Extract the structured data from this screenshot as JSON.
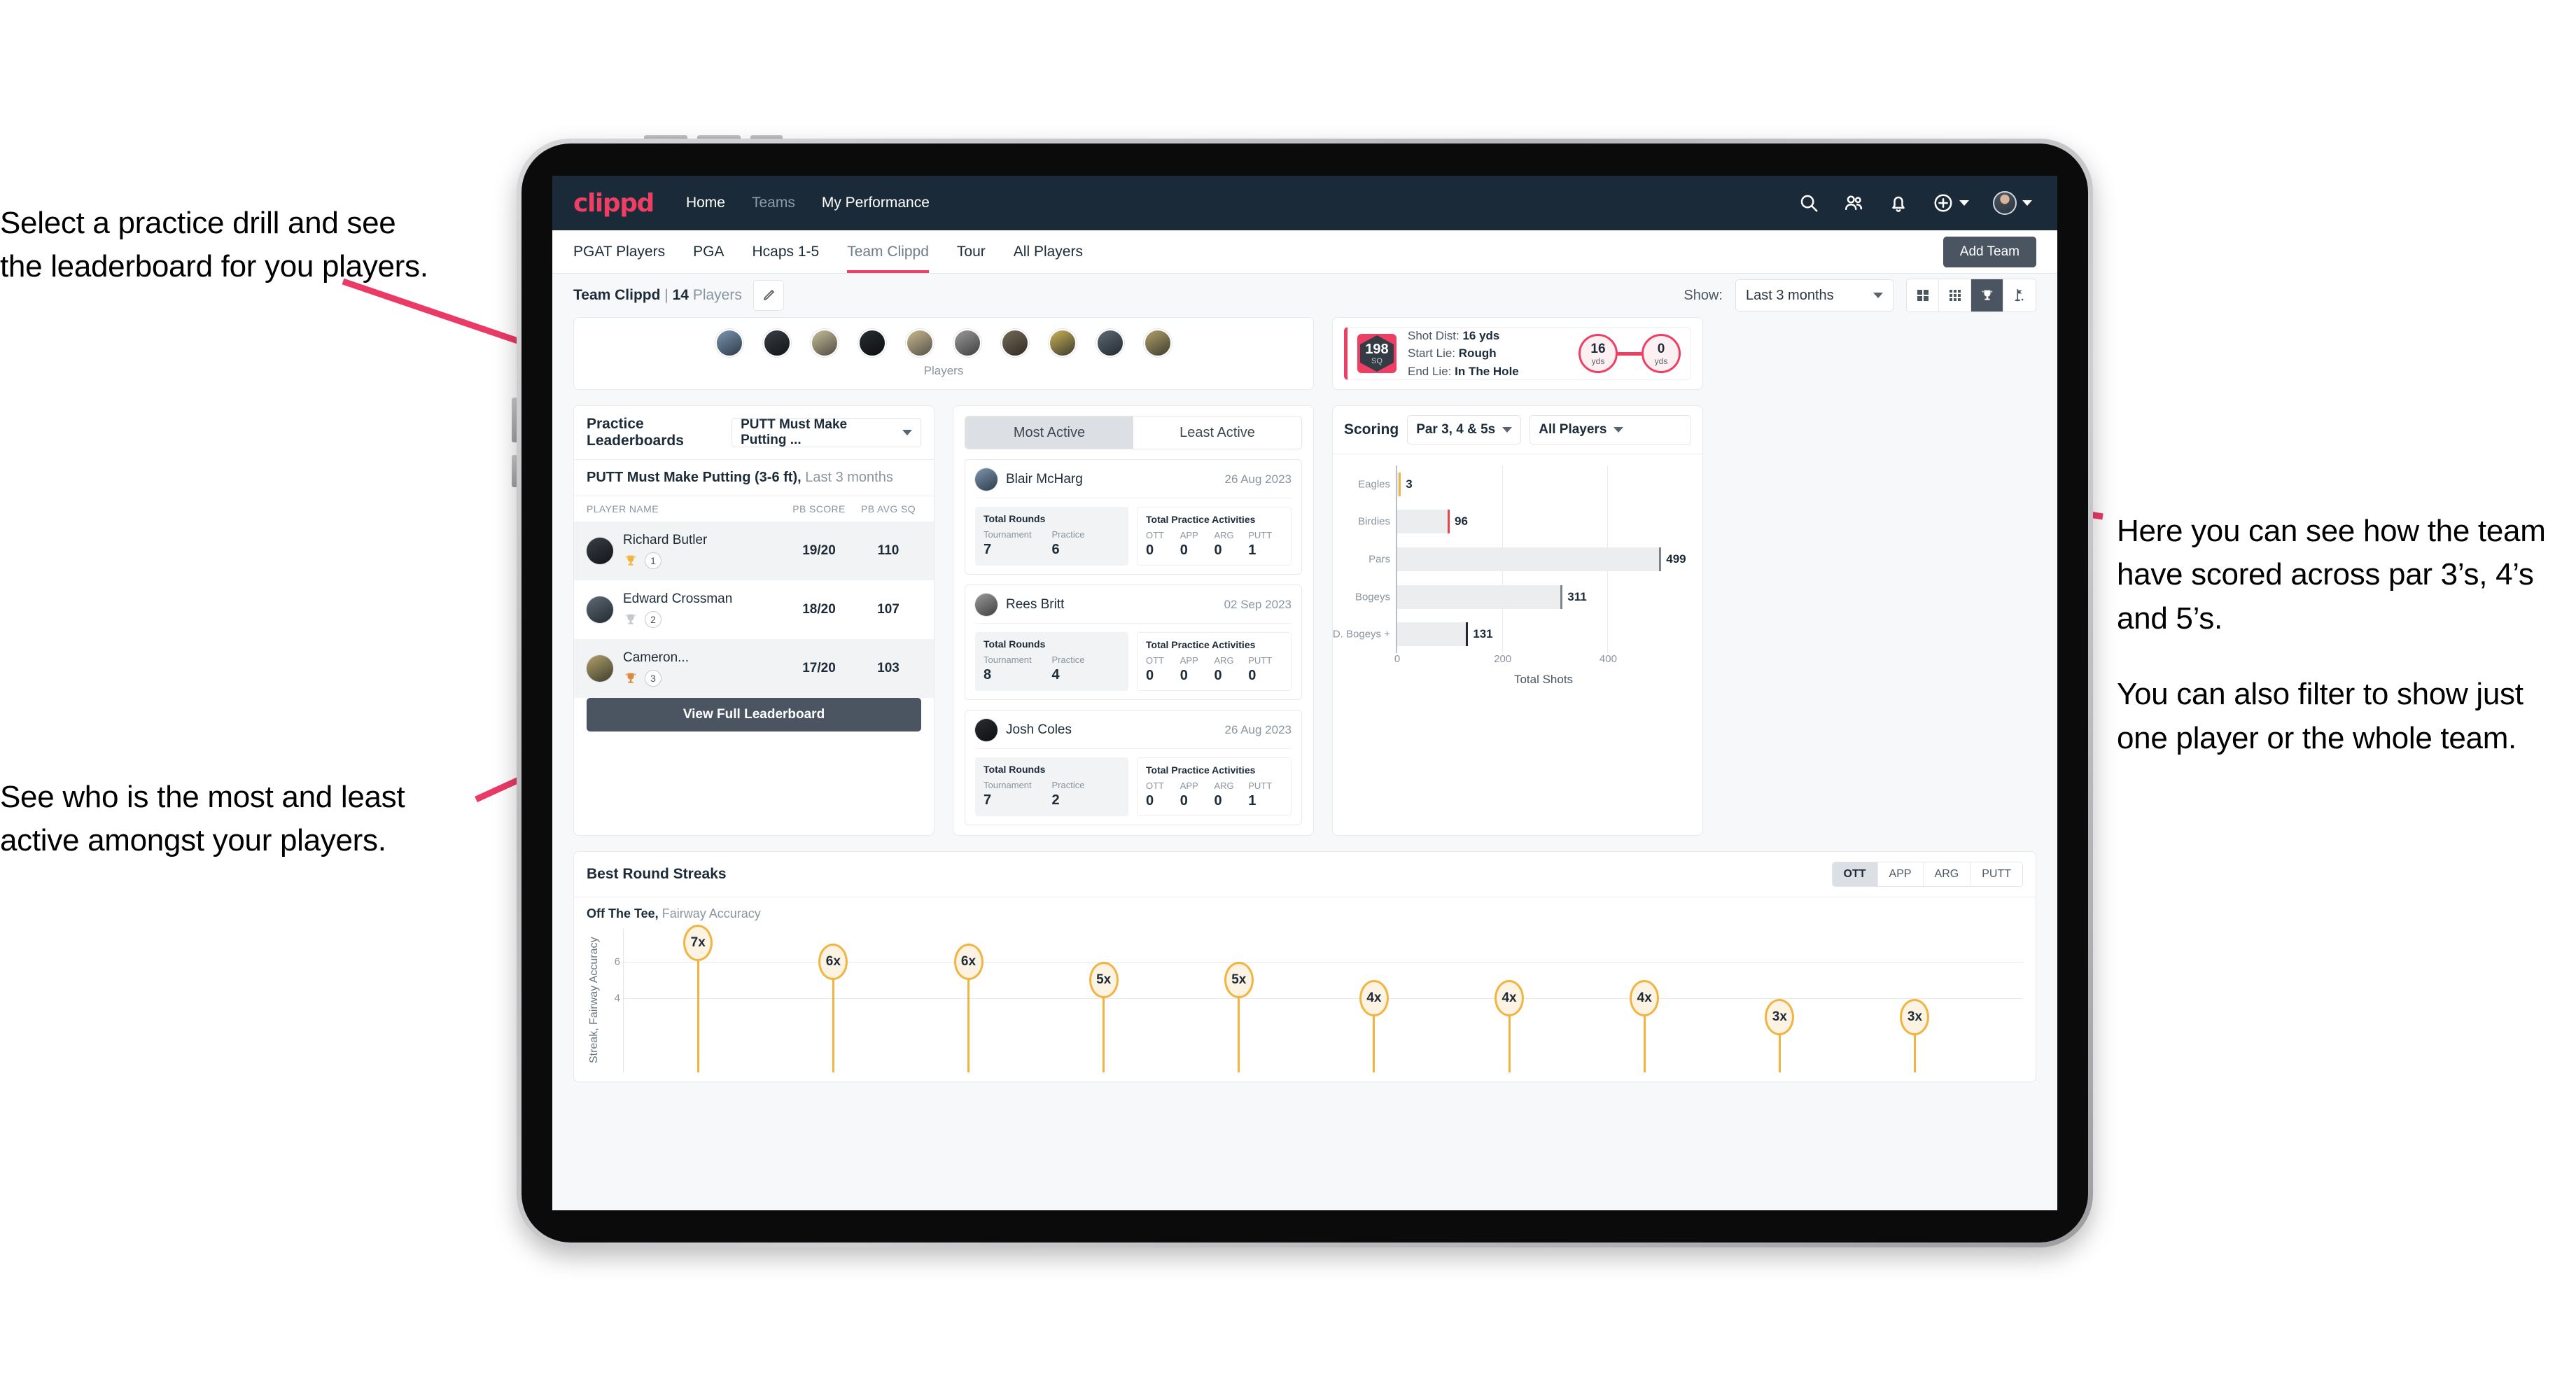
{
  "annotations": {
    "top_left": [
      "Select a practice drill and see",
      "the leaderboard for you players."
    ],
    "bottom_left": [
      "See who is the most and least",
      "active amongst your players."
    ],
    "right": [
      "Here you can see how the team have scored across par 3’s, 4’s and 5’s.",
      "You can also filter to show just one player or the whole team."
    ]
  },
  "appbar": {
    "logo": "clippd",
    "nav": [
      {
        "label": "Home",
        "active": true
      },
      {
        "label": "Teams",
        "active": false
      },
      {
        "label": "My Performance",
        "active": true
      }
    ],
    "icons": [
      "search-icon",
      "people-icon",
      "bell-icon",
      "plus-circle-icon",
      "avatar"
    ],
    "brand_color": "#ef3e63",
    "bar_color": "#1b2a38"
  },
  "tabs": [
    {
      "label": "PGAT Players",
      "active": false
    },
    {
      "label": "PGA",
      "active": false
    },
    {
      "label": "Hcaps 1-5",
      "active": false
    },
    {
      "label": "Team Clippd",
      "active": true
    },
    {
      "label": "Tour",
      "active": false
    },
    {
      "label": "All Players",
      "active": false
    }
  ],
  "add_team_button": "Add Team",
  "toolbar": {
    "team_name": "Team Clippd",
    "separator": "|",
    "player_count": "14",
    "players_word": "Players",
    "edit_icon": "pencil-icon",
    "show_label": "Show:",
    "show_value": "Last 3 months",
    "view_modes": [
      {
        "name": "grid-2x2-icon",
        "active": false
      },
      {
        "name": "grid-3x3-icon",
        "active": false
      },
      {
        "name": "trophy-icon",
        "active": true
      },
      {
        "name": "golf-flag-icon",
        "active": false
      }
    ]
  },
  "players_strip": {
    "label": "Players",
    "count": 10
  },
  "shot_card": {
    "sq_value": "198",
    "sq_label": "SQ",
    "lines": [
      {
        "label": "Shot Dist:",
        "value": "16 yds"
      },
      {
        "label": "Start Lie:",
        "value": "Rough"
      },
      {
        "label": "End Lie:",
        "value": "In The Hole"
      }
    ],
    "start_distance": {
      "value": "16",
      "unit": "yds"
    },
    "end_distance": {
      "value": "0",
      "unit": "yds"
    }
  },
  "leaderboard": {
    "title": "Practice Leaderboards",
    "drill_select": "PUTT Must Make Putting ...",
    "subtitle_bold": "PUTT Must Make Putting (3-6 ft),",
    "subtitle_rest": "Last 3 months",
    "columns": [
      "PLAYER NAME",
      "PB SCORE",
      "PB AVG SQ"
    ],
    "rows": [
      {
        "name": "Richard Butler",
        "rank": "1",
        "medal": "gold",
        "score": "19/20",
        "avg": "110"
      },
      {
        "name": "Edward Crossman",
        "rank": "2",
        "medal": "silver",
        "score": "18/20",
        "avg": "107"
      },
      {
        "name": "Cameron...",
        "rank": "3",
        "medal": "bronze",
        "score": "17/20",
        "avg": "103"
      }
    ],
    "button": "View Full Leaderboard"
  },
  "activity": {
    "tabs": [
      {
        "label": "Most Active",
        "active": true
      },
      {
        "label": "Least Active",
        "active": false
      }
    ],
    "rounds_title": "Total Rounds",
    "practice_title": "Total Practice Activities",
    "rounds_labels": [
      "Tournament",
      "Practice"
    ],
    "practice_labels": [
      "OTT",
      "APP",
      "ARG",
      "PUTT"
    ],
    "cards": [
      {
        "name": "Blair McHarg",
        "date": "26 Aug 2023",
        "rounds": [
          "7",
          "6"
        ],
        "practice": [
          "0",
          "0",
          "0",
          "1"
        ]
      },
      {
        "name": "Rees Britt",
        "date": "02 Sep 2023",
        "rounds": [
          "8",
          "4"
        ],
        "practice": [
          "0",
          "0",
          "0",
          "0"
        ]
      },
      {
        "name": "Josh Coles",
        "date": "26 Aug 2023",
        "rounds": [
          "7",
          "2"
        ],
        "practice": [
          "0",
          "0",
          "0",
          "1"
        ]
      }
    ]
  },
  "scoring": {
    "title": "Scoring",
    "par_filter": "Par 3, 4 & 5s",
    "player_filter": "All Players"
  },
  "streaks": {
    "title": "Best Round Streaks",
    "toggle": [
      {
        "label": "OTT",
        "active": true
      },
      {
        "label": "APP",
        "active": false
      },
      {
        "label": "ARG",
        "active": false
      },
      {
        "label": "PUTT",
        "active": false
      }
    ],
    "subtitle_bold": "Off The Tee,",
    "subtitle_rest": "Fairway Accuracy"
  },
  "chart_data": [
    {
      "type": "bar",
      "orientation": "horizontal",
      "title": "Scoring",
      "categories": [
        "Eagles",
        "Birdies",
        "Pars",
        "Bogeys",
        "D. Bogeys +"
      ],
      "values": [
        3,
        96,
        499,
        311,
        131
      ],
      "cap_colors": [
        "#f2b441",
        "#e8434a",
        "#7c848c",
        "#7c848c",
        "#1d2b39"
      ],
      "bar_color": "#ebedef",
      "xlabel": "Total Shots",
      "ylabel": "",
      "xlim": [
        0,
        560
      ],
      "xticks": [
        0,
        200,
        400
      ],
      "grid": true,
      "legend": "none"
    },
    {
      "type": "scatter",
      "subtype": "lollipop",
      "title": "Best Round Streaks",
      "series_name": "Off The Tee, Fairway Accuracy",
      "labels": [
        "7x",
        "6x",
        "6x",
        "5x",
        "5x",
        "4x",
        "4x",
        "4x",
        "3x",
        "3x"
      ],
      "values": [
        7,
        6,
        6,
        5,
        5,
        4,
        4,
        4,
        3,
        3
      ],
      "ylabel": "Streak, Fairway Accuracy",
      "yticks": [
        4,
        6
      ],
      "ylim": [
        0,
        7.8
      ],
      "marker_color": "#f2b441",
      "grid": true,
      "legend": "none"
    }
  ]
}
